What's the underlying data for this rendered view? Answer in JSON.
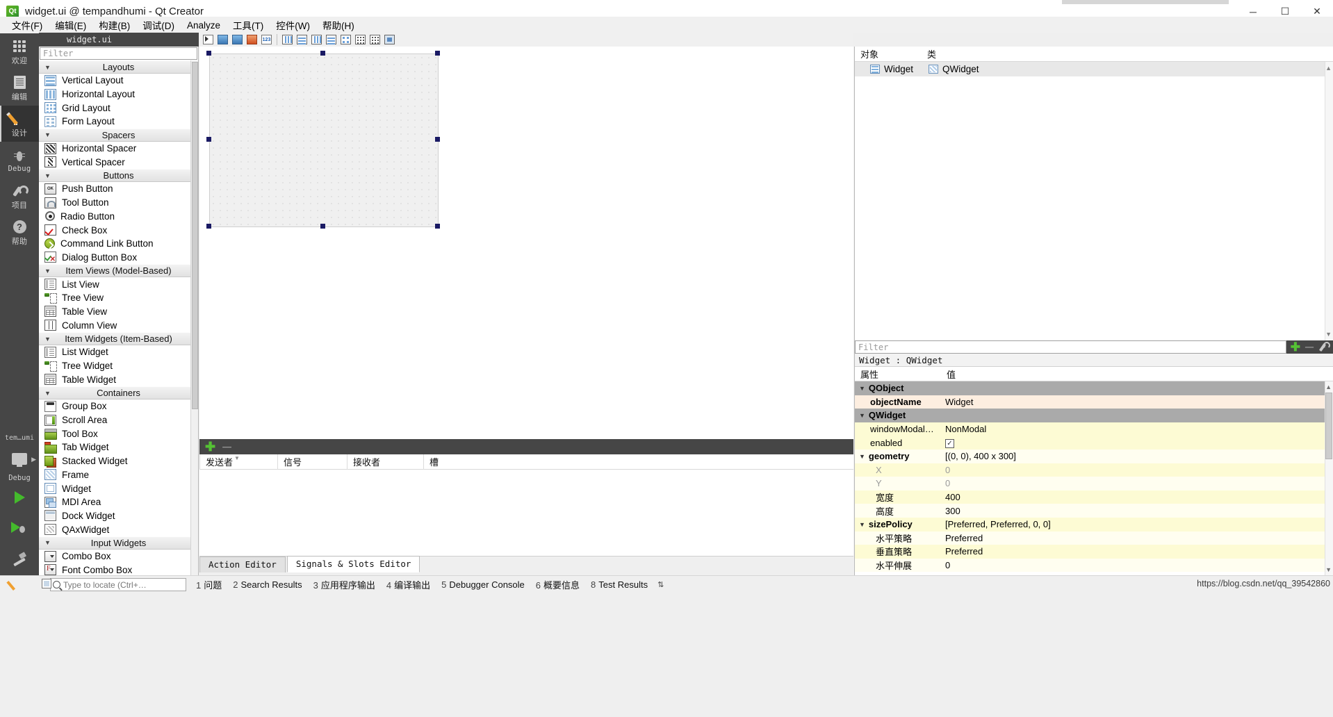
{
  "window": {
    "title": "widget.ui @ tempandhumi - Qt Creator",
    "minimize": "─",
    "maximize": "☐",
    "close": "✕"
  },
  "menubar": {
    "items": [
      {
        "label": "文件(F)"
      },
      {
        "label": "编辑(E)"
      },
      {
        "label": "构建(B)"
      },
      {
        "label": "调试(D)"
      },
      {
        "label": "Analyze"
      },
      {
        "label": "工具(T)"
      },
      {
        "label": "控件(W)"
      },
      {
        "label": "帮助(H)"
      }
    ]
  },
  "modebar": {
    "items": [
      {
        "label": "欢迎",
        "icon": "grid-icon",
        "active": false
      },
      {
        "label": "编辑",
        "icon": "document-icon",
        "active": false
      },
      {
        "label": "设计",
        "icon": "pencil-icon",
        "active": true
      },
      {
        "label": "Debug",
        "icon": "bug-icon",
        "active": false
      },
      {
        "label": "项目",
        "icon": "wrench-icon",
        "active": false
      },
      {
        "label": "帮助",
        "icon": "help-icon",
        "active": false
      }
    ],
    "kit": {
      "project": "tem…umi",
      "build_config": "Debug",
      "run_label": "run-icon",
      "debug_label": "debug-icon",
      "build_label": "build-icon"
    }
  },
  "editor_toolbar": {
    "filename": "widget.ui",
    "close_glyph": "✕",
    "caret_glyph": "▾"
  },
  "designer_toolbar": {
    "buttons": [
      {
        "name": "edit-widgets-button",
        "icon": "arrow-icon"
      },
      {
        "name": "edit-signals-slots-button",
        "icon": "signal-slot-icon"
      },
      {
        "name": "edit-buddies-button",
        "icon": "buddy-icon"
      },
      {
        "name": "edit-tab-order-button",
        "icon": "taborder-icon"
      },
      {
        "name": "layout-horizontally-button",
        "icon": "hlayout-icon"
      },
      {
        "name": "layout-vertically-button",
        "icon": "vlayout-icon"
      },
      {
        "name": "layout-in-splitter-h-button",
        "icon": "hsplitter-icon"
      },
      {
        "name": "layout-in-splitter-v-button",
        "icon": "vsplitter-icon"
      },
      {
        "name": "layout-in-form-button",
        "icon": "formlayout-icon"
      },
      {
        "name": "layout-in-grid-button",
        "icon": "gridlayout-icon"
      },
      {
        "name": "break-layout-button",
        "icon": "breaklayout-icon"
      },
      {
        "name": "adjust-size-button",
        "icon": "adjustsize-icon"
      }
    ]
  },
  "widget_box": {
    "filter_placeholder": "Filter",
    "groups": [
      {
        "title": "Layouts",
        "items": [
          {
            "label": "Vertical Layout",
            "icon": "vertical-layout-icon",
            "cls": "ic-vlayout"
          },
          {
            "label": "Horizontal Layout",
            "icon": "horizontal-layout-icon",
            "cls": "ic-hlayout"
          },
          {
            "label": "Grid Layout",
            "icon": "grid-layout-icon",
            "cls": "ic-grid"
          },
          {
            "label": "Form Layout",
            "icon": "form-layout-icon",
            "cls": "ic-form"
          }
        ]
      },
      {
        "title": "Spacers",
        "items": [
          {
            "label": "Horizontal Spacer",
            "icon": "horizontal-spacer-icon",
            "cls": "ic-hspacer"
          },
          {
            "label": "Vertical Spacer",
            "icon": "vertical-spacer-icon",
            "cls": "ic-vspacer"
          }
        ]
      },
      {
        "title": "Buttons",
        "items": [
          {
            "label": "Push Button",
            "icon": "push-button-icon",
            "cls": "ic-push"
          },
          {
            "label": "Tool Button",
            "icon": "tool-button-icon",
            "cls": "ic-tool"
          },
          {
            "label": "Radio Button",
            "icon": "radio-button-icon",
            "cls": "ic-radio"
          },
          {
            "label": "Check Box",
            "icon": "check-box-icon",
            "cls": "ic-check"
          },
          {
            "label": "Command Link Button",
            "icon": "command-link-icon",
            "cls": "ic-cmdlink"
          },
          {
            "label": "Dialog Button Box",
            "icon": "dialog-button-box-icon",
            "cls": "ic-dlgbtn"
          }
        ]
      },
      {
        "title": "Item Views (Model-Based)",
        "items": [
          {
            "label": "List View",
            "icon": "list-view-icon",
            "cls": "ic-listview"
          },
          {
            "label": "Tree View",
            "icon": "tree-view-icon",
            "cls": "ic-treeview"
          },
          {
            "label": "Table View",
            "icon": "table-view-icon",
            "cls": "ic-tableview"
          },
          {
            "label": "Column View",
            "icon": "column-view-icon",
            "cls": "ic-colview"
          }
        ]
      },
      {
        "title": "Item Widgets (Item-Based)",
        "items": [
          {
            "label": "List Widget",
            "icon": "list-widget-icon",
            "cls": "ic-listview"
          },
          {
            "label": "Tree Widget",
            "icon": "tree-widget-icon",
            "cls": "ic-treeview"
          },
          {
            "label": "Table Widget",
            "icon": "table-widget-icon",
            "cls": "ic-tableview"
          }
        ]
      },
      {
        "title": "Containers",
        "items": [
          {
            "label": "Group Box",
            "icon": "group-box-icon",
            "cls": "ic-groupbox"
          },
          {
            "label": "Scroll Area",
            "icon": "scroll-area-icon",
            "cls": "ic-scrollarea"
          },
          {
            "label": "Tool Box",
            "icon": "tool-box-icon",
            "cls": "ic-toolbox"
          },
          {
            "label": "Tab Widget",
            "icon": "tab-widget-icon",
            "cls": "ic-tabwidget"
          },
          {
            "label": "Stacked Widget",
            "icon": "stacked-widget-icon",
            "cls": "ic-stacked"
          },
          {
            "label": "Frame",
            "icon": "frame-icon",
            "cls": "ic-frame"
          },
          {
            "label": "Widget",
            "icon": "widget-icon",
            "cls": "ic-widget"
          },
          {
            "label": "MDI Area",
            "icon": "mdi-area-icon",
            "cls": "ic-mdi"
          },
          {
            "label": "Dock Widget",
            "icon": "dock-widget-icon",
            "cls": "ic-dock"
          },
          {
            "label": "QAxWidget",
            "icon": "qax-widget-icon",
            "cls": "ic-qax"
          }
        ]
      },
      {
        "title": "Input Widgets",
        "items": [
          {
            "label": "Combo Box",
            "icon": "combo-box-icon",
            "cls": "ic-combo"
          },
          {
            "label": "Font Combo Box",
            "icon": "font-combo-box-icon",
            "cls": "ic-fontcombo"
          }
        ]
      }
    ]
  },
  "canvas": {
    "form_name": "Widget",
    "form_width": 330,
    "form_height": 250
  },
  "signals_slots": {
    "add_glyph": "✚",
    "remove_glyph": "─",
    "columns": [
      {
        "label": "发送者"
      },
      {
        "label": "信号"
      },
      {
        "label": "接收者"
      },
      {
        "label": "槽"
      }
    ],
    "rows": []
  },
  "editor_tabs": {
    "tabs": [
      {
        "label": "Action Editor",
        "active": false
      },
      {
        "label": "Signals & Slots Editor",
        "active": true
      }
    ]
  },
  "object_inspector": {
    "columns": [
      {
        "label": "对象"
      },
      {
        "label": "类"
      }
    ],
    "rows": [
      {
        "object": "Widget",
        "class": "QWidget"
      }
    ]
  },
  "property_editor": {
    "filter_placeholder": "Filter",
    "add_glyph": "✚",
    "remove_glyph": "─",
    "title": "Widget : QWidget",
    "columns": [
      {
        "label": "属性"
      },
      {
        "label": "值"
      }
    ],
    "rows": [
      {
        "kind": "group",
        "name": "QObject",
        "value": "",
        "chev": "∨"
      },
      {
        "kind": "peach",
        "name": "objectName",
        "value": "Widget",
        "indent": "sub2"
      },
      {
        "kind": "group",
        "name": "QWidget",
        "value": "",
        "chev": "∨"
      },
      {
        "kind": "yellow",
        "name": "windowModal…",
        "value": "NonModal",
        "indent": "sub2"
      },
      {
        "kind": "yellow",
        "name": "enabled",
        "value": "",
        "indent": "sub2",
        "checkbox": true,
        "checked": "✓"
      },
      {
        "kind": "cream",
        "name": "geometry",
        "value": "[(0, 0), 400 x 300]",
        "indent": "sub2",
        "bold": true,
        "chev": "∨"
      },
      {
        "kind": "yellow",
        "name": "X",
        "value": "0",
        "indent": "sub",
        "dim": true
      },
      {
        "kind": "cream",
        "name": "Y",
        "value": "0",
        "indent": "sub",
        "dim": true
      },
      {
        "kind": "yellow",
        "name": "宽度",
        "value": "400",
        "indent": "sub"
      },
      {
        "kind": "cream",
        "name": "高度",
        "value": "300",
        "indent": "sub"
      },
      {
        "kind": "yellow",
        "name": "sizePolicy",
        "value": "[Preferred, Preferred, 0, 0]",
        "indent": "sub2",
        "bold": true,
        "chev": "∨"
      },
      {
        "kind": "cream",
        "name": "水平策略",
        "value": "Preferred",
        "indent": "sub"
      },
      {
        "kind": "yellow",
        "name": "垂直策略",
        "value": "Preferred",
        "indent": "sub"
      },
      {
        "kind": "cream",
        "name": "水平伸展",
        "value": "0",
        "indent": "sub"
      }
    ]
  },
  "statusbar": {
    "locate_placeholder": "Type to locate (Ctrl+…",
    "panes": [
      {
        "num": "1",
        "label": "问题"
      },
      {
        "num": "2",
        "label": "Search Results"
      },
      {
        "num": "3",
        "label": "应用程序输出"
      },
      {
        "num": "4",
        "label": "编译输出"
      },
      {
        "num": "5",
        "label": "Debugger Console"
      },
      {
        "num": "6",
        "label": "概要信息"
      },
      {
        "num": "8",
        "label": "Test Results"
      }
    ],
    "updown_glyph": "⇅",
    "watermark": "https://blog.csdn.net/qq_39542860"
  }
}
